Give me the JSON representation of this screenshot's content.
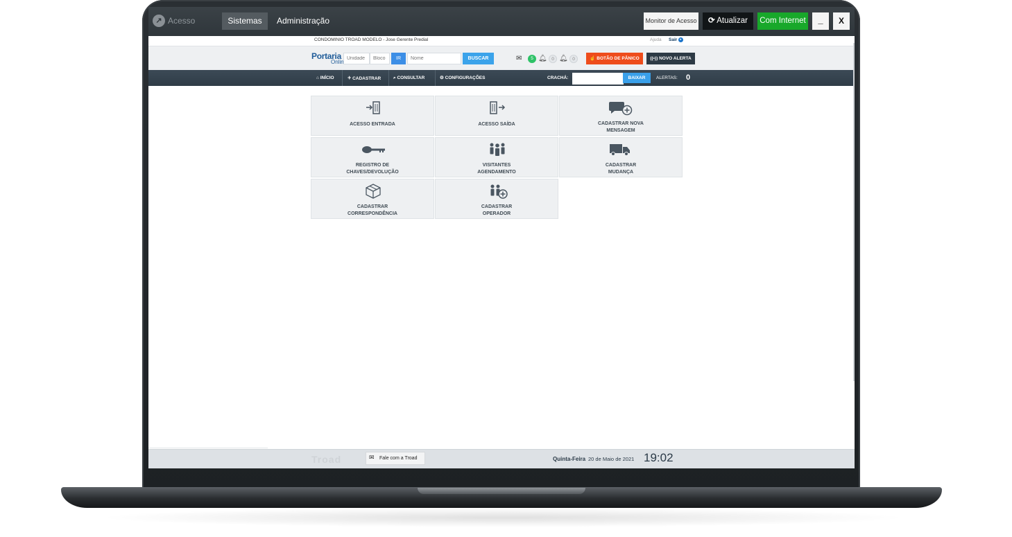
{
  "titlebar": {
    "app_name": "Acesso",
    "menu": [
      "Sistemas",
      "Administração"
    ],
    "buttons": {
      "monitor": "Monitor de Acesso",
      "atualizar": "Atualizar",
      "internet": "Com Internet",
      "minimize": "_",
      "close": "X"
    }
  },
  "info": {
    "condominio": "CONDOMINIO TROAD MODELO - Jose Gerente Predial",
    "help": "Ajuda",
    "exit": "Sair"
  },
  "search": {
    "logo_top": "Portaria",
    "logo_bottom": "Online",
    "unidade_placeholder": "Unidade",
    "bloco_placeholder": "Bloco",
    "ir_label": "IR",
    "nome_placeholder": "Nome",
    "buscar_label": "BUSCAR",
    "messages_count": "5",
    "bell1_count": "0",
    "bell2_count": "0",
    "panico_label": "BOTÃO DE PÂNICO",
    "alerta_label": "NOVO ALERTA"
  },
  "nav": {
    "items": [
      "INÍCIO",
      "CADASTRAR",
      "CONSULTAR",
      "CONFIGURAÇÕES"
    ],
    "cracha_label": "CRACHÁ:",
    "baixar_label": "BAIXAR",
    "alertas_label": "ALERTAS:",
    "alertas_count": "0"
  },
  "tiles": [
    {
      "label1": "ACESSO ENTRADA",
      "label2": "",
      "icon": "door-enter-icon"
    },
    {
      "label1": "ACESSO SAÍDA",
      "label2": "",
      "icon": "door-exit-icon"
    },
    {
      "label1": "CADASTRAR NOVA",
      "label2": "MENSAGEM",
      "icon": "message-add-icon"
    },
    {
      "label1": "REGISTRO DE",
      "label2": "CHAVES/DEVOLUÇÃO",
      "icon": "key-icon"
    },
    {
      "label1": "VISITANTES",
      "label2": "AGENDAMENTO",
      "icon": "visitors-icon"
    },
    {
      "label1": "CADASTRAR",
      "label2": "MUDANÇA",
      "icon": "truck-icon"
    },
    {
      "label1": "CADASTRAR",
      "label2": "CORRESPONDÊNCIA",
      "icon": "package-icon"
    },
    {
      "label1": "CADASTRAR",
      "label2": "OPERADOR",
      "icon": "operator-add-icon"
    }
  ],
  "footer": {
    "brand": "Troad",
    "fale_label": "Fale com a Troad",
    "day": "Quinta-Feira",
    "date": "20 de Maio de 2021",
    "time": "19:02"
  },
  "colors": {
    "titlebar": "#2f363b",
    "nav": "#2f3c47",
    "internet_green": "#18a82a",
    "panic_orange": "#ee4c1b",
    "primary_blue": "#3ba3ea"
  }
}
